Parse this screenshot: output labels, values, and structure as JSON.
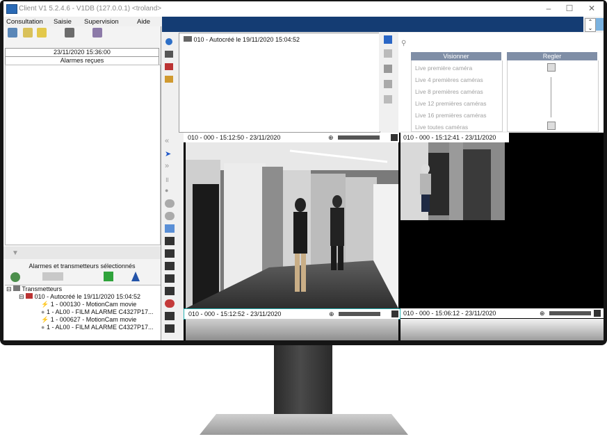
{
  "window": {
    "title": "Client V1 5.2.4.6 - V1DB (127.0.0.1) <troland>",
    "minimize": "–",
    "maximize": "☐",
    "close": "✕"
  },
  "menu": [
    "Consultation",
    "Saisie",
    "Supervision",
    "Aide"
  ],
  "left": {
    "datetime": "23/11/2020 15:36:00",
    "alarms_header": "Alarmes reçues",
    "selected_label": "Alarmes et transmetteurs sélectionnés",
    "tree": [
      "Transmetteurs",
      "010 - Autocréé le 19/11/2020 15:04:52",
      "1 - 000130 - MotionCam movie",
      "1 - AL00 - FILM ALARME C4327P17...",
      "1 - 000627 - MotionCam movie",
      "1 - AL00 - FILM ALARME C4327P17..."
    ]
  },
  "camera_tree": {
    "item": "010 - Autocréé le 19/11/2020 15:04:52"
  },
  "controls": {
    "visionner_title": "Visionner",
    "regler_title": "Regler",
    "live_options": [
      "Live première caméra",
      "Live 4 premières caméras",
      "Live 8 premières caméras",
      "Live 12 premières caméras",
      "Live 16 premières caméras",
      "Live toutes caméras"
    ]
  },
  "cameras": {
    "main": "010 - 000 - 15:12:50 - 23/11/2020",
    "top_right": "010 - 000 - 15:12:41 - 23/11/2020",
    "bottom_left": "010 - 000 - 15:12:52 - 23/11/2020",
    "bottom_right": "010 - 000 - 15:06:12 - 23/11/2020"
  },
  "colors": {
    "top_strip": "#143c73",
    "panel_head": "#7f8ea6",
    "screen_bg": "#f0f0f0"
  }
}
